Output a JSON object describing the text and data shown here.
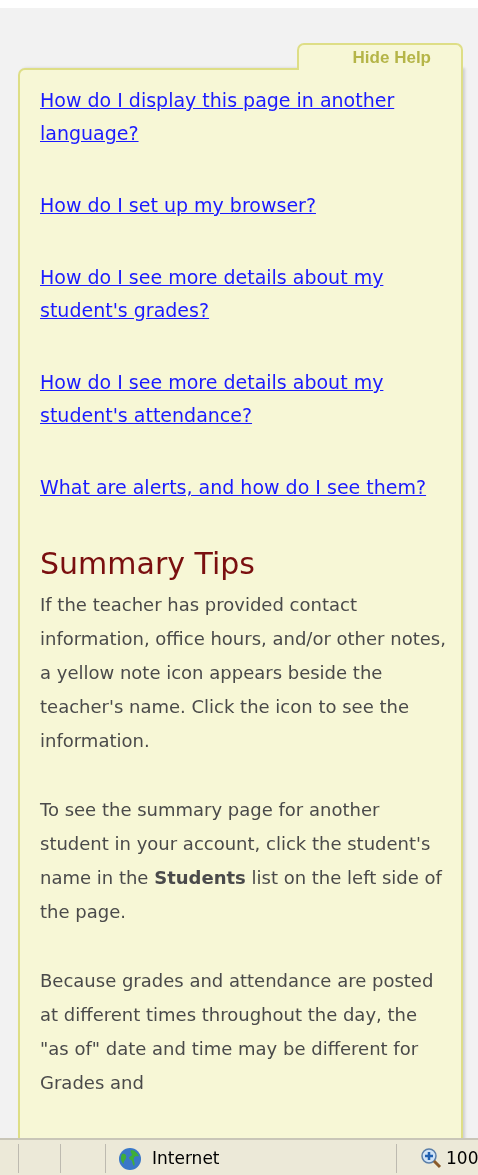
{
  "help_panel": {
    "tab": "Hide Help",
    "links": [
      "How do I display this page in another language?",
      "How do I set up my browser?",
      "How do I see more details about my student's grades?",
      "How do I see more details about my student's attendance?",
      "What are alerts, and how do I see them?"
    ],
    "heading": "Summary Tips",
    "paragraphs": [
      "If the teacher has provided contact information, office hours, and/or other notes, a yellow note icon appears beside the teacher's name. Click the icon to see the information.",
      "To see the summary page for another student in your account, click the student's name in the **Students** list on the left side of the page.",
      "Because grades and attendance are posted at different times throughout the day, the \"as of\" date and time may be different for Grades and"
    ]
  },
  "status_bar": {
    "zone": "Internet",
    "zoom": "100"
  }
}
